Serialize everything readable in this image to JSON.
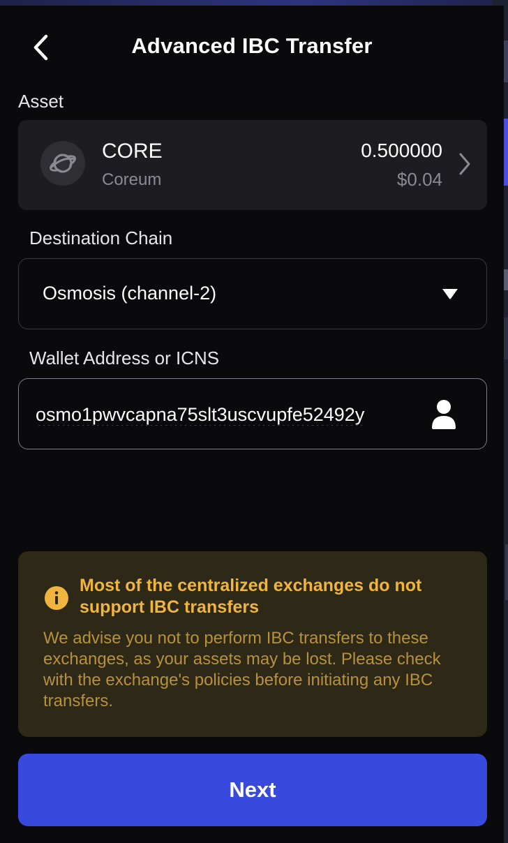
{
  "header": {
    "title": "Advanced IBC Transfer",
    "back_icon": "chevron-left-icon"
  },
  "asset_section": {
    "label": "Asset",
    "asset": {
      "icon": "planet-icon",
      "symbol": "CORE",
      "name": "Coreum",
      "amount": "0.500000",
      "value": "$0.04"
    }
  },
  "destination": {
    "label": "Destination Chain",
    "selected": "Osmosis (channel-2)"
  },
  "address": {
    "label": "Wallet Address or ICNS",
    "value": "osmo1pwvcapna75slt3uscvupfe52492y",
    "icon": "user-icon"
  },
  "warning": {
    "icon": "info-icon",
    "title": "Most of the centralized exchanges do not support IBC transfers",
    "body": "We advise you not to perform IBC transfers to these exchanges, as your assets may be lost. Please check with the exchange's policies before initiating any IBC transfers.",
    "colors": {
      "title": "#f0b53e",
      "body": "#b7913c",
      "background": "#2e2816"
    }
  },
  "next_button": {
    "label": "Next",
    "color": "#3849de"
  }
}
